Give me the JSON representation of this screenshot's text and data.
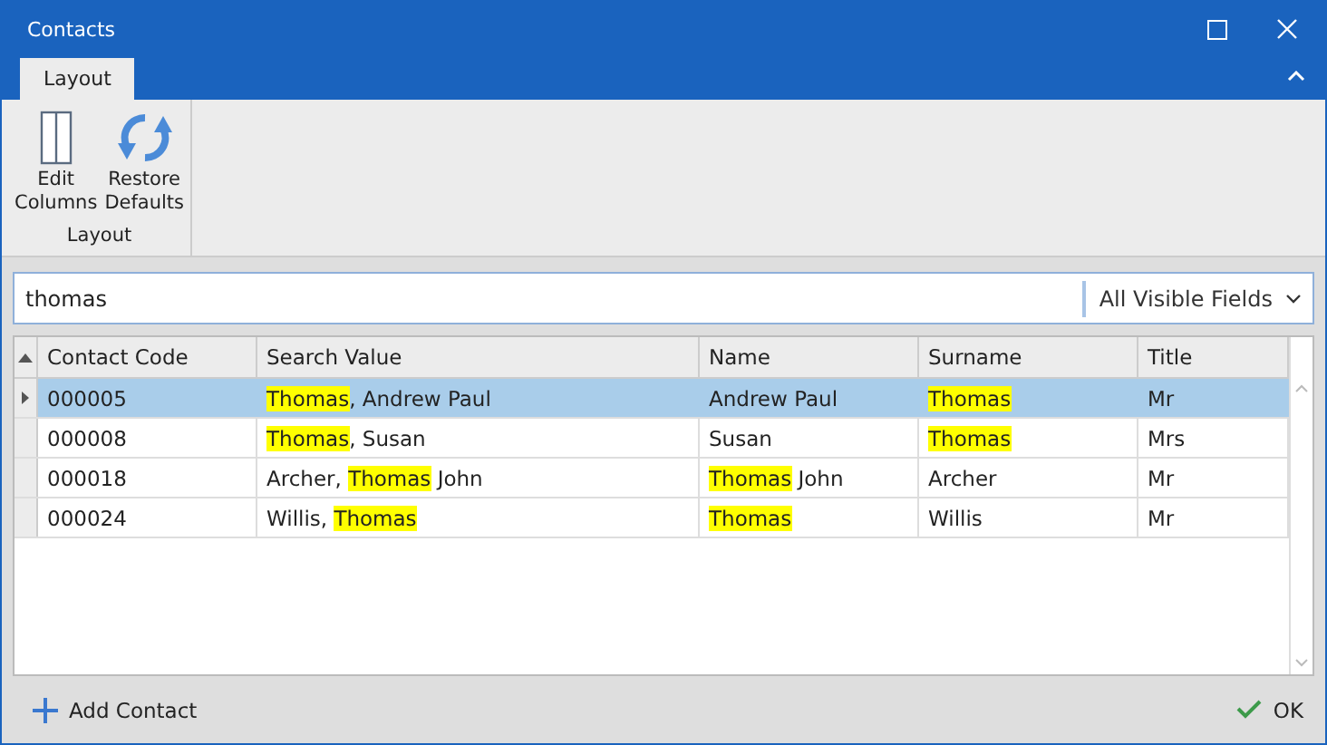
{
  "window": {
    "title": "Contacts"
  },
  "ribbon": {
    "tabs": [
      {
        "label": "Layout",
        "selected": true
      }
    ],
    "groups": [
      {
        "label": "Layout",
        "buttons": [
          {
            "kind": "columns",
            "label": "Edit Columns"
          },
          {
            "kind": "restore",
            "label": "Restore Defaults"
          }
        ]
      }
    ]
  },
  "search": {
    "value": "thomas",
    "scope": "All Visible Fields"
  },
  "table": {
    "columns": [
      "Contact Code",
      "Search Value",
      "Name",
      "Surname",
      "Title"
    ],
    "rows": [
      {
        "selected": true,
        "cells": [
          [
            {
              "text": "000005",
              "highlighted": false
            }
          ],
          [
            {
              "text": "Thomas",
              "highlighted": true
            },
            {
              "text": ", Andrew Paul",
              "highlighted": false
            }
          ],
          [
            {
              "text": "Andrew Paul",
              "highlighted": false
            }
          ],
          [
            {
              "text": "Thomas",
              "highlighted": true
            }
          ],
          [
            {
              "text": "Mr",
              "highlighted": false
            }
          ]
        ]
      },
      {
        "selected": false,
        "cells": [
          [
            {
              "text": "000008",
              "highlighted": false
            }
          ],
          [
            {
              "text": "Thomas",
              "highlighted": true
            },
            {
              "text": ", Susan",
              "highlighted": false
            }
          ],
          [
            {
              "text": "Susan",
              "highlighted": false
            }
          ],
          [
            {
              "text": "Thomas",
              "highlighted": true
            }
          ],
          [
            {
              "text": "Mrs",
              "highlighted": false
            }
          ]
        ]
      },
      {
        "selected": false,
        "cells": [
          [
            {
              "text": "000018",
              "highlighted": false
            }
          ],
          [
            {
              "text": "Archer, ",
              "highlighted": false
            },
            {
              "text": "Thomas",
              "highlighted": true
            },
            {
              "text": " John",
              "highlighted": false
            }
          ],
          [
            {
              "text": "Thomas",
              "highlighted": true
            },
            {
              "text": " John",
              "highlighted": false
            }
          ],
          [
            {
              "text": "Archer",
              "highlighted": false
            }
          ],
          [
            {
              "text": "Mr",
              "highlighted": false
            }
          ]
        ]
      },
      {
        "selected": false,
        "cells": [
          [
            {
              "text": "000024",
              "highlighted": false
            }
          ],
          [
            {
              "text": "Willis, ",
              "highlighted": false
            },
            {
              "text": "Thomas",
              "highlighted": true
            }
          ],
          [
            {
              "text": "Thomas",
              "highlighted": true
            }
          ],
          [
            {
              "text": "Willis",
              "highlighted": false
            }
          ],
          [
            {
              "text": "Mr",
              "highlighted": false
            }
          ]
        ]
      }
    ]
  },
  "footer": {
    "add_button": "Add Contact",
    "ok_button": "OK"
  }
}
